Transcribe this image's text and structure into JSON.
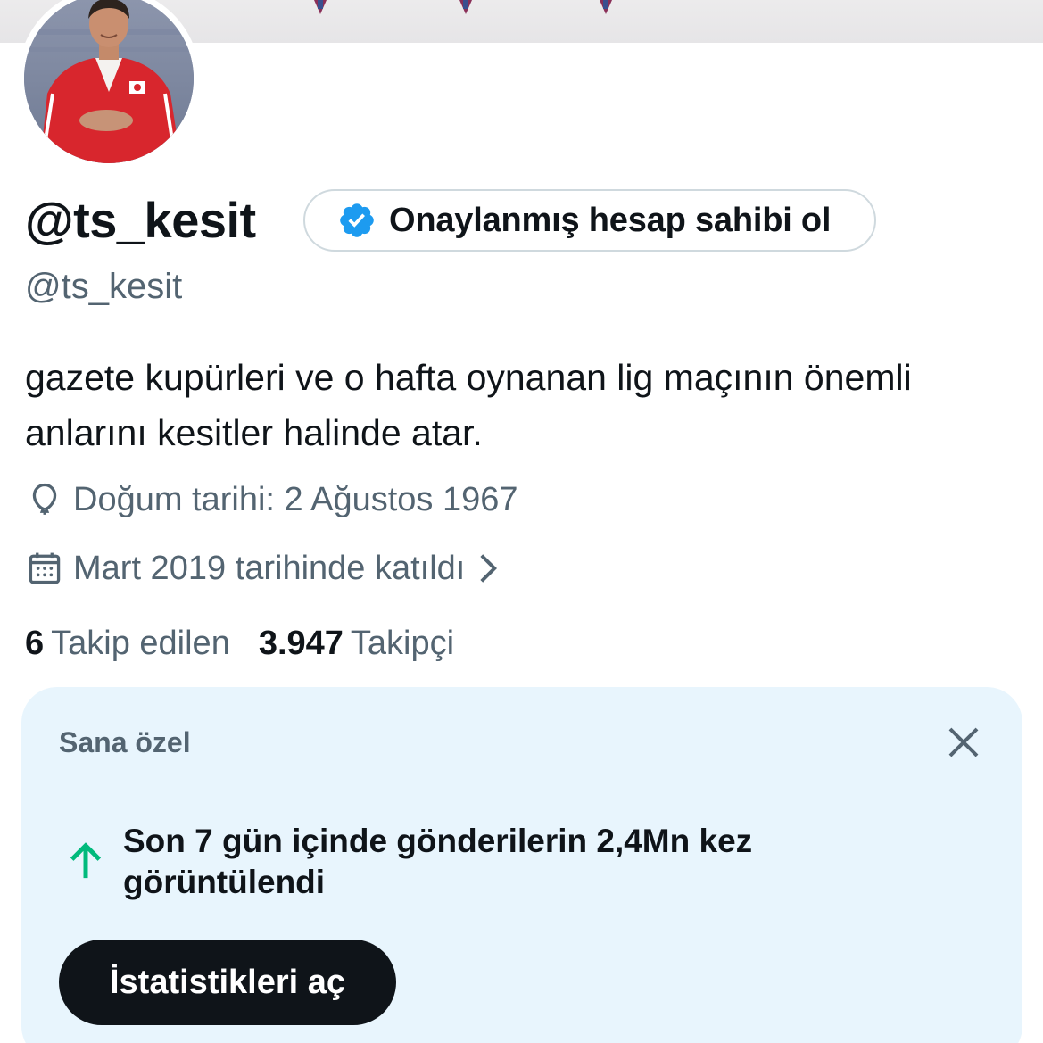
{
  "profile": {
    "display_name": "@ts_kesit",
    "handle": "@ts_kesit",
    "avatar_icon": "profile-photo",
    "verify_prompt": {
      "label": "Onaylanmış hesap sahibi ol",
      "icon": "verified-badge-icon",
      "badge_color": "#1d9bf0"
    },
    "bio": "gazete kupürleri ve o hafta oynanan lig maçının önemli anlarını kesitler halinde atar.",
    "birth": {
      "icon": "balloon-icon",
      "text": "Doğum tarihi: 2 Ağustos 1967"
    },
    "joined": {
      "icon": "calendar-icon",
      "text": "Mart 2019 tarihinde katıldı"
    },
    "following": {
      "count": "6",
      "label": "Takip edilen"
    },
    "followers": {
      "count": "3.947",
      "label": "Takipçi"
    }
  },
  "insight_card": {
    "title": "Sana özel",
    "close_icon": "close-icon",
    "trend_icon": "arrow-up-icon",
    "trend_color": "#00ba7c",
    "message": "Son 7 gün içinde gönderilerin 2,4Mn kez görüntülendi",
    "button_label": "İstatistikleri aç",
    "background": "#e8f5fd"
  }
}
